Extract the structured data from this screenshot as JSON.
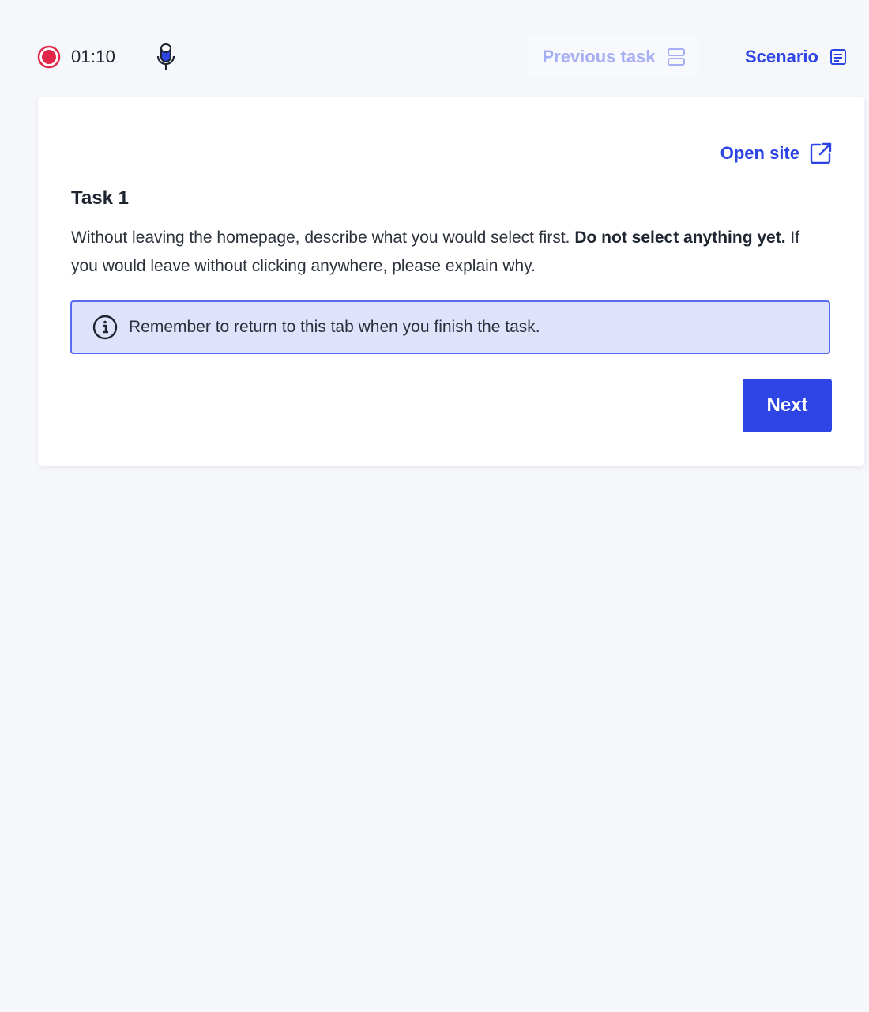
{
  "topbar": {
    "timer": "01:10",
    "recording_color": "#e0264b",
    "mic_icon": "microphone-icon",
    "previous_task_label": "Previous task",
    "previous_task_icon": "split-panel-icon",
    "scenario_label": "Scenario",
    "scenario_icon": "document-icon"
  },
  "card": {
    "open_site_label": "Open site",
    "open_site_icon": "external-link-icon",
    "task_title": "Task 1",
    "description": {
      "part1": "Without leaving the homepage, describe what you would select first.",
      "bold1": "Do not select anything yet.",
      "part2": "If you would leave without clicking anywhere, please explain why."
    },
    "notice_icon": "info-icon",
    "notice_text": "Remember to return to this tab when you finish the task.",
    "next_label": "Next"
  },
  "colors": {
    "accent": "#2e45e6",
    "accent_disabled": "#a6aef4",
    "notice_bg": "#dfe2fb",
    "notice_border": "#5a6af0",
    "page_bg": "#f5f7fb"
  }
}
